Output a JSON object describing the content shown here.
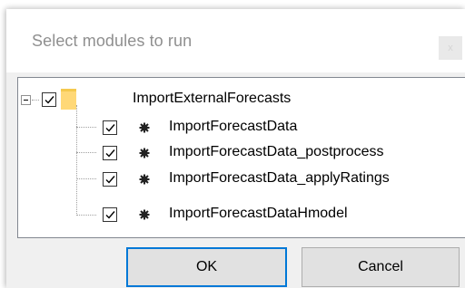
{
  "dialog": {
    "title": "Select modules to run",
    "close_label": "x"
  },
  "tree": {
    "root": {
      "label": "ImportExternalForecasts",
      "checked": true,
      "expanded": true,
      "icon": "folder-icon"
    },
    "children": [
      {
        "label": "ImportForecastData",
        "checked": true,
        "icon": "gear-icon"
      },
      {
        "label": "ImportForecastData_postprocess",
        "checked": true,
        "icon": "gear-icon"
      },
      {
        "label": "ImportForecastData_applyRatings",
        "checked": true,
        "icon": "gear-icon"
      },
      {
        "label": "ImportForecastDataHmodel",
        "checked": true,
        "icon": "gear-icon"
      }
    ]
  },
  "buttons": {
    "ok_label": "OK",
    "cancel_label": "Cancel"
  },
  "colors": {
    "accent": "#0078d7",
    "folder": "#ffd877",
    "title_text": "#8f8f8f"
  }
}
